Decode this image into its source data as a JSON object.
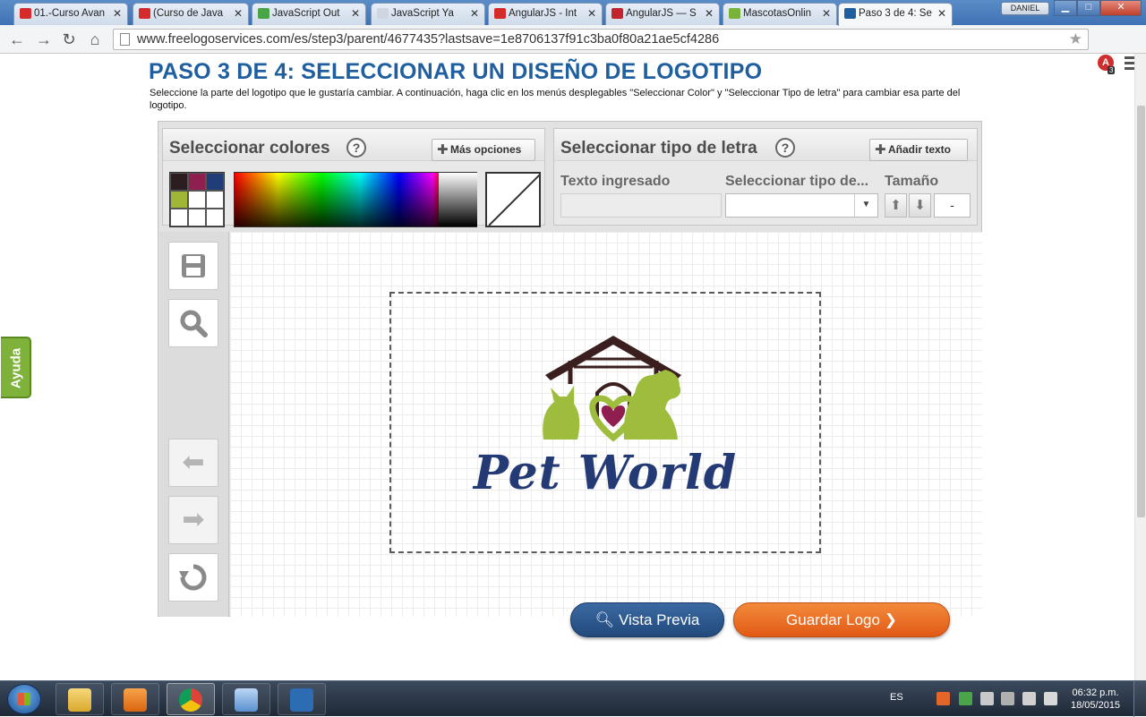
{
  "browser": {
    "tabs": [
      {
        "label": "01.-Curso Avan",
        "favicon_color": "#d62b2b"
      },
      {
        "label": "(Curso de Java",
        "favicon_color": "#d62b2b"
      },
      {
        "label": "JavaScript Out",
        "favicon_color": "#4aa548"
      },
      {
        "label": "JavaScript Ya",
        "favicon_color": "#cfd6df"
      },
      {
        "label": "AngularJS - Int",
        "favicon_color": "#d62b2b"
      },
      {
        "label": "AngularJS — S",
        "favicon_color": "#c3252c"
      },
      {
        "label": "MascotasOnlin",
        "favicon_color": "#79b33b"
      },
      {
        "label": "Paso 3 de 4: Se",
        "favicon_color": "#1f5f9f"
      }
    ],
    "window_user": "DANIEL",
    "url": "www.freelogoservices.com/es/step3/parent/4677435?lastsave=1e8706137f91c3ba0f80a21ae5cf4286",
    "extension_badge": "3"
  },
  "page": {
    "title": "PASO 3 DE 4: SELECCIONAR UN DISEÑO DE LOGOTIPO",
    "description": "Seleccione la parte del logotipo que le gustaría cambiar. A continuación, haga clic en los menús desplegables \"Seleccionar Color\" y \"Seleccionar Tipo de letra\" para cambiar esa parte del logotipo."
  },
  "colors_panel": {
    "title": "Seleccionar colores",
    "help": "?",
    "more_button": "Más opciones",
    "swatches": [
      "#2c1d20",
      "#8e1f4e",
      "#213d78",
      "#9fb637",
      "#ffffff",
      "#ffffff",
      "#ffffff",
      "#ffffff",
      "#ffffff"
    ]
  },
  "font_panel": {
    "title": "Seleccionar tipo de letra",
    "help": "?",
    "add_text_button": "Añadir texto",
    "col_text": "Texto ingresado",
    "col_font": "Seleccionar tipo de...",
    "col_size": "Tamaño",
    "text_value": "",
    "font_value": "",
    "size_value": "-"
  },
  "canvas": {
    "brand_text": "Pet World",
    "brand_color": "#233a74",
    "pet_color": "#9ebd3c",
    "roof_color": "#3b1f1f",
    "heart_color": "#8e1f4e"
  },
  "actions": {
    "preview": "Vista Previa",
    "save": "Guardar Logo"
  },
  "help_tab": "Ayuda",
  "taskbar": {
    "lang": "ES",
    "time": "06:32 p.m.",
    "date": "18/05/2015"
  }
}
